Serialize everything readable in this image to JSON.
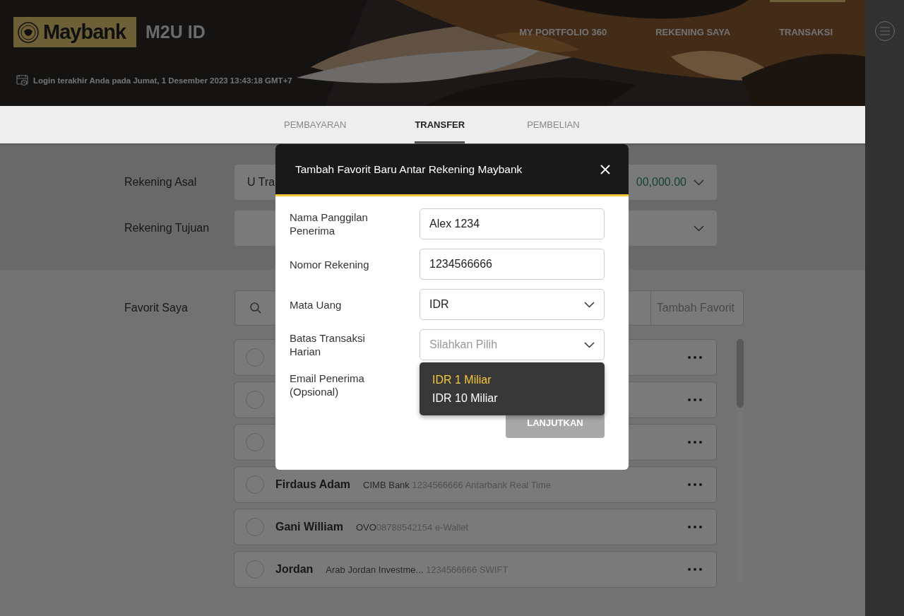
{
  "header": {
    "logo_text": "Maybank",
    "app_name": "M2U ID",
    "nav": [
      "MY PORTFOLIO 360",
      "REKENING SAYA",
      "TRANSAKSI"
    ],
    "last_login": "Login terakhir Anda pada Jumat, 1 Desember 2023 13:43:18 GMT+7"
  },
  "tabs": [
    {
      "label": "PEMBAYARAN",
      "selected": false
    },
    {
      "label": "TRANSFER",
      "selected": true
    },
    {
      "label": "PEMBELIAN",
      "selected": false
    }
  ],
  "form": {
    "source_label": "Rekening Asal",
    "source_value": "U Tra",
    "source_amount": "00,000.00",
    "target_label": "Rekening Tujuan"
  },
  "favorites": {
    "label": "Favorit Saya",
    "add_button": "Tambah Favorit",
    "rows": [
      {
        "selected": false
      },
      {
        "selected": false
      },
      {
        "selected": false
      },
      {
        "selected": false,
        "name": "Firdaus Adam",
        "bank": "CIMB Bank",
        "detail": " 1234566666 Antarbank Real Time"
      },
      {
        "selected": false,
        "name": "Gani William",
        "bank": "OVO",
        "detail": "08788542154 e-Wallet"
      },
      {
        "selected": false,
        "name": "Jordan",
        "bank": "Arab Jordan Investme...",
        "detail": " 1234566666 SWIFT"
      }
    ]
  },
  "modal": {
    "title": "Tambah Favorit Baru Antar Rekening Maybank",
    "fields": [
      {
        "kind": "text",
        "label": "Nama Panggilan Penerima",
        "value": "Alex 1234"
      },
      {
        "kind": "text",
        "label": "Nomor Rekening",
        "value": "1234566666"
      },
      {
        "kind": "select",
        "label": "Mata Uang",
        "value": "IDR"
      },
      {
        "kind": "select",
        "label": "Batas Transaksi Harian",
        "placeholder": "Silahkan Pilih",
        "open": true,
        "options": [
          {
            "label": "IDR 1 Miliar",
            "selected": true
          },
          {
            "label": "IDR 10 Miliar",
            "selected": false
          }
        ]
      },
      {
        "kind": "hidden",
        "label": "Email Penerima (Opsional)"
      }
    ],
    "submit": {
      "label": "LANJUTKAN",
      "disabled": true
    }
  }
}
